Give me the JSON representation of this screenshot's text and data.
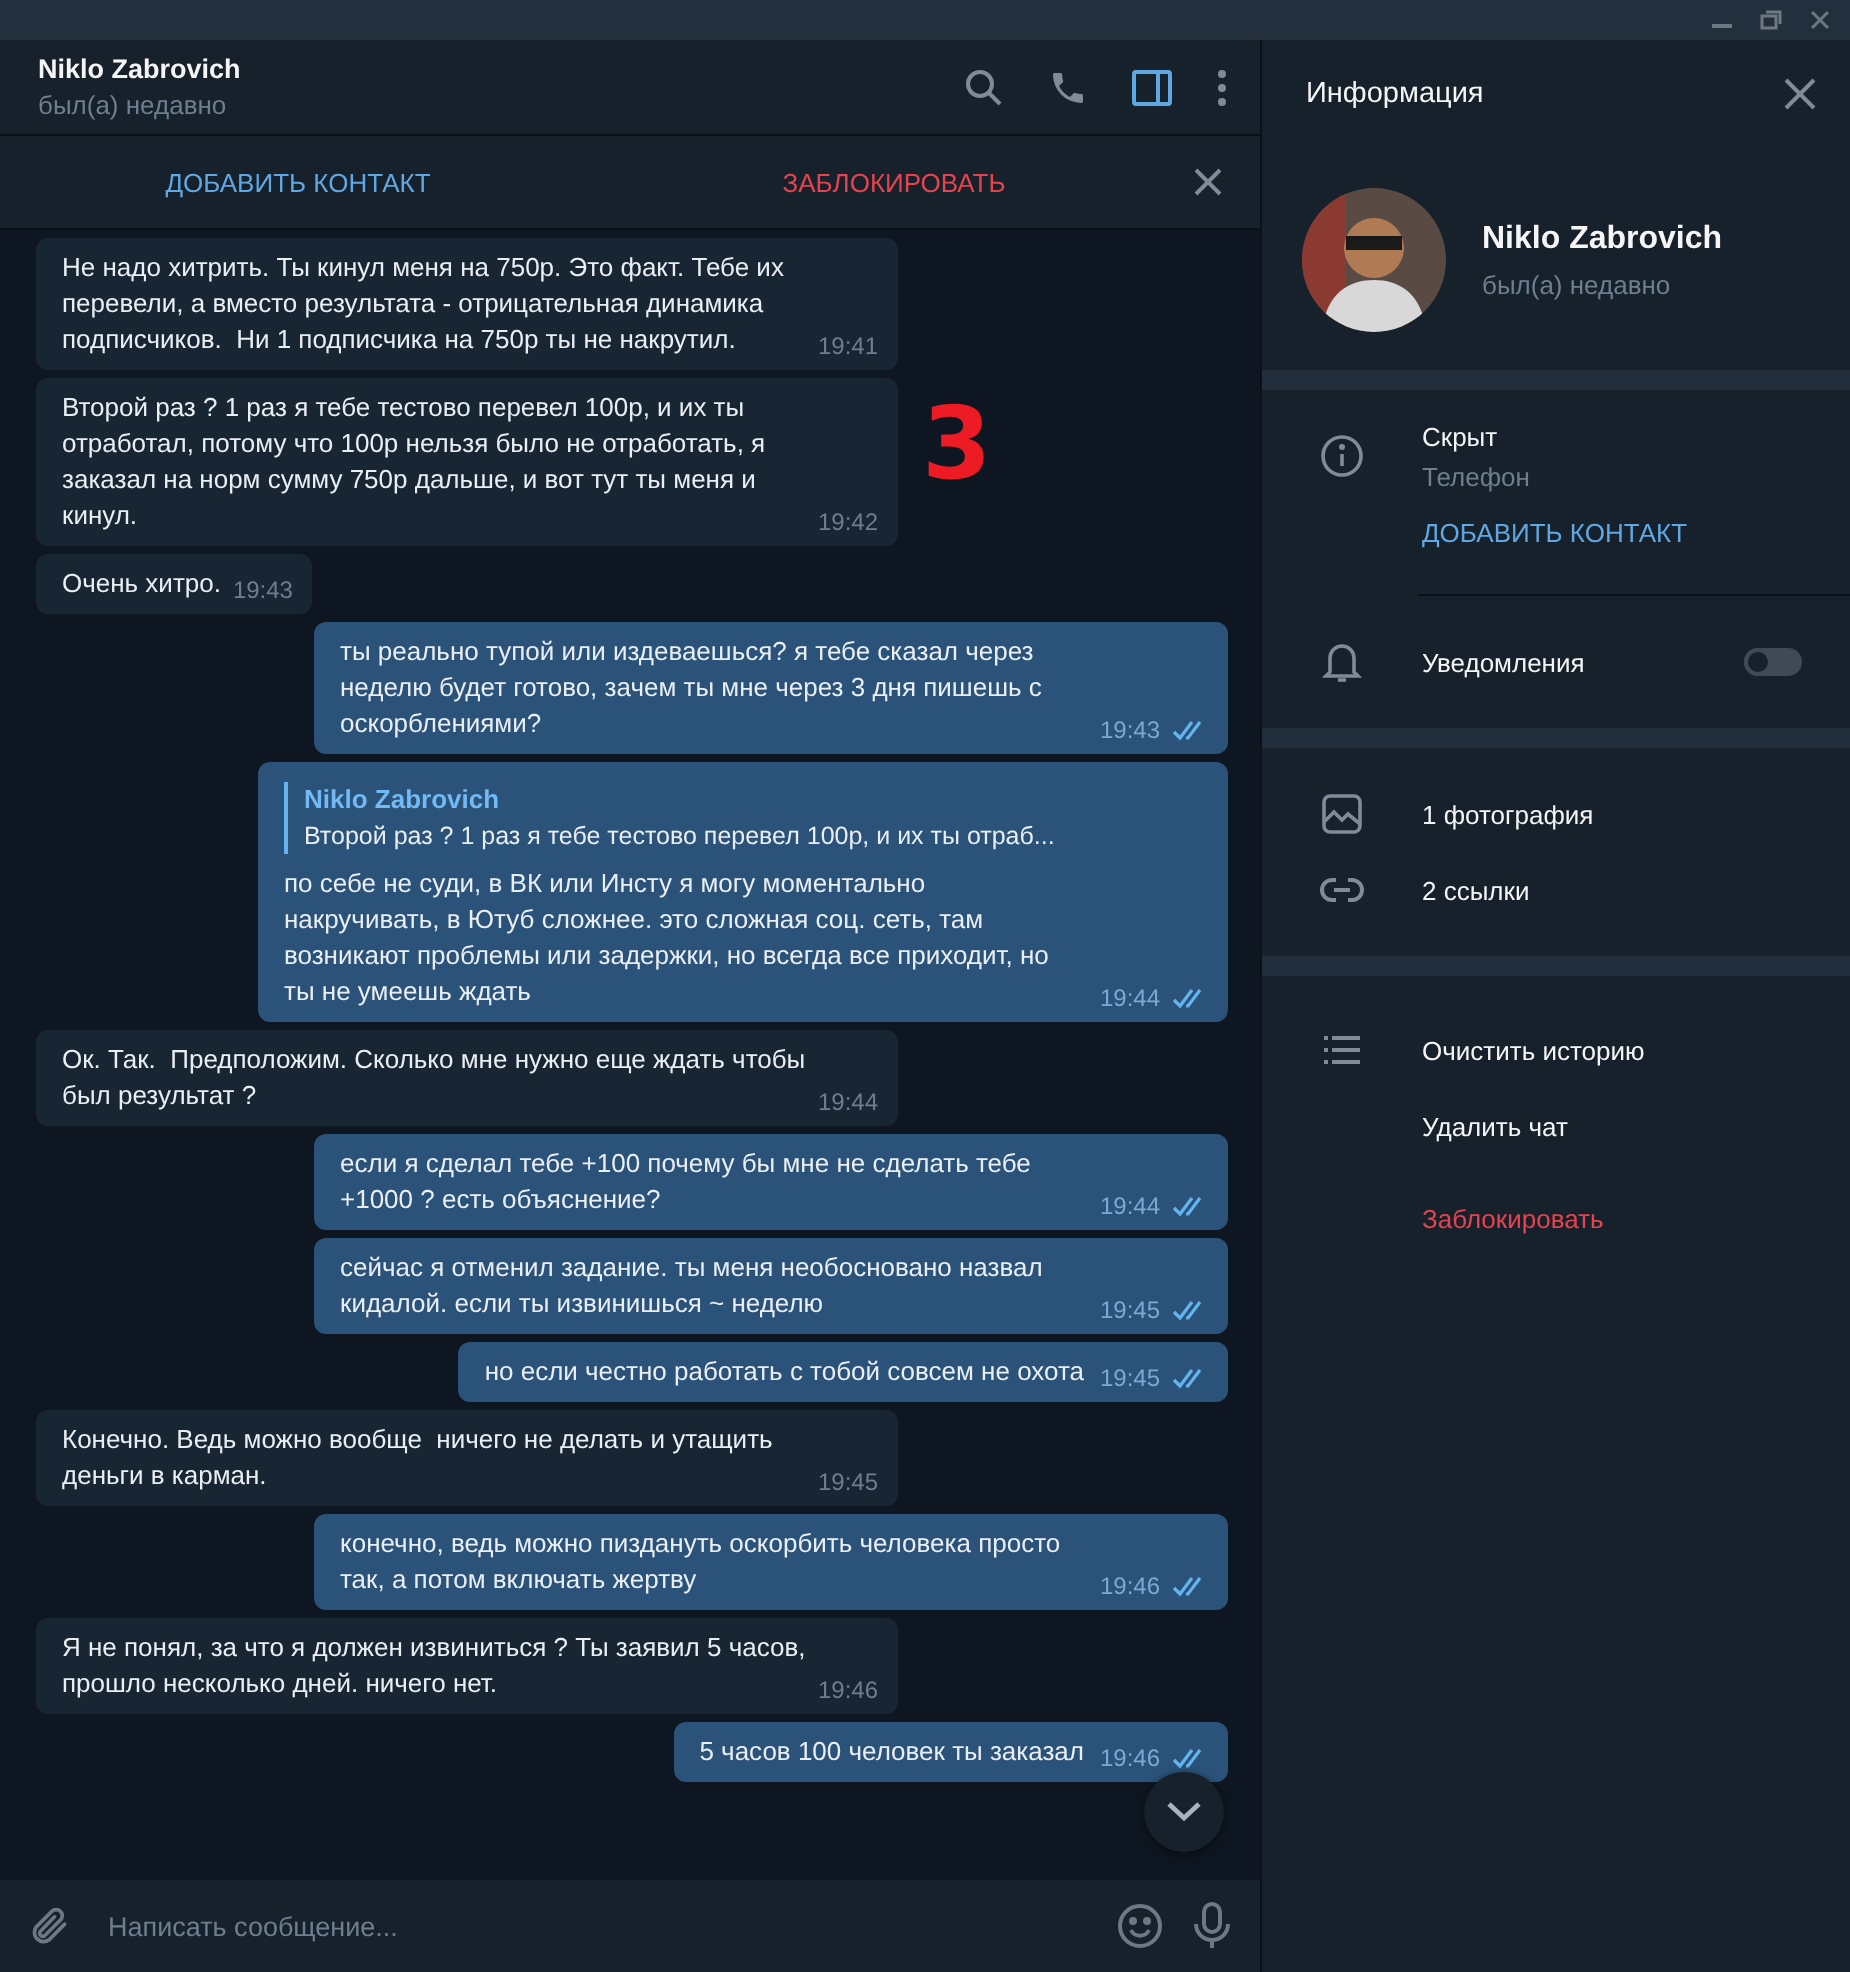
{
  "chat_header": {
    "name": "Niklo Zabrovich",
    "status": "был(а) недавно",
    "info_selected": true
  },
  "action_bar": {
    "add_contact": "ДОБАВИТЬ КОНТАКТ",
    "block": "ЗАБЛОКИРОВАТЬ"
  },
  "annotation": "3",
  "messages": [
    {
      "kind": "incoming",
      "text": "Не надо хитрить. Ты кинул меня на 750р. Это факт. Тебе их перевели, а вместо результата - отрицательная динамика подписчиков.  Ни 1 подписчика на 750р ты не накрутил.",
      "time": "19:41"
    },
    {
      "kind": "incoming",
      "text": "Второй раз ? 1 раз я тебе тестово перевел 100р, и их ты отработал, потому что 100р нельзя было не отработать, я заказал на норм сумму 750р дальше, и вот тут ты меня и кинул.",
      "time": "19:42"
    },
    {
      "kind": "incoming",
      "text": "Очень хитро.",
      "time": "19:43"
    },
    {
      "kind": "outgoing",
      "text": "ты реально тупой или издеваешься? я тебе сказал через неделю будет готово, зачем ты мне через 3 дня пишешь с оскорблениями?",
      "time": "19:43",
      "read": true
    },
    {
      "kind": "outgoing",
      "reply": {
        "author": "Niklo Zabrovich",
        "text": "Второй раз ? 1 раз я тебе тестово перевел 100р, и их ты отраб..."
      },
      "text": "по себе не суди, в ВК или Инсту я могу моментально накручивать, в Ютуб сложнее. это сложная соц. сеть, там возникают проблемы или задержки, но всегда все приходит, но ты не умеешь ждать",
      "time": "19:44",
      "read": true
    },
    {
      "kind": "incoming",
      "text": "Ок. Так.  Предположим. Сколько мне нужно еще ждать чтобы был результат ?",
      "time": "19:44"
    },
    {
      "kind": "outgoing",
      "text": "если я сделал тебе +100 почему бы мне не сделать тебе +1000 ? есть объяснение?",
      "time": "19:44",
      "read": true
    },
    {
      "kind": "outgoing",
      "text": "сейчас я отменил задание. ты меня необосновано назвал кидалой. если ты извинишься ~ неделю",
      "time": "19:45",
      "read": true
    },
    {
      "kind": "outgoing",
      "text": "но если честно работать с тобой совсем не охота",
      "time": "19:45",
      "read": true
    },
    {
      "kind": "incoming",
      "text": "Конечно. Ведь можно вообще  ничего не делать и утащить деньги в карман.",
      "time": "19:45"
    },
    {
      "kind": "outgoing",
      "text": "конечно, ведь можно пиздануть оскорбить человека просто так, а потом включать жертву",
      "time": "19:46",
      "read": true
    },
    {
      "kind": "incoming",
      "text": "Я не понял, за что я должен извиниться ? Ты заявил 5 часов, прошло несколько дней. ничего нет.",
      "time": "19:46"
    },
    {
      "kind": "outgoing",
      "text": "5 часов 100 человек ты заказал",
      "time": "19:46",
      "read": true
    }
  ],
  "composer": {
    "placeholder": "Написать сообщение..."
  },
  "info_panel": {
    "title": "Информация",
    "profile": {
      "name": "Niklo Zabrovich",
      "status": "был(а) недавно"
    },
    "phone": {
      "value": "Скрыт",
      "label": "Телефон"
    },
    "add_contact": "ДОБАВИТЬ КОНТАКТ",
    "notifications": {
      "label": "Уведомления",
      "on": false
    },
    "media": [
      {
        "kind": "photo",
        "label": "1 фотография"
      },
      {
        "kind": "link",
        "label": "2 ссылки"
      }
    ],
    "actions": [
      {
        "kind": "history",
        "label": "Очистить историю",
        "danger": false
      },
      {
        "kind": "delete",
        "label": "Удалить чат",
        "danger": false
      },
      {
        "kind": "block",
        "label": "Заблокировать",
        "danger": true
      }
    ]
  }
}
